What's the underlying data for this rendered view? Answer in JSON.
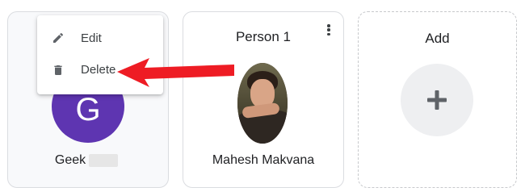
{
  "cards": [
    {
      "name_prefix": "Geek",
      "avatar_letter": "G"
    },
    {
      "title": "Person 1",
      "name": "Mahesh Makvana"
    },
    {
      "title": "Add"
    }
  ],
  "menu": {
    "items": [
      {
        "label": "Edit",
        "icon": "pencil-icon"
      },
      {
        "label": "Delete",
        "icon": "trash-icon"
      }
    ]
  },
  "colors": {
    "avatar": "#5e35b1",
    "arrow": "#ee1c24",
    "add_circle": "#eeeff1"
  }
}
